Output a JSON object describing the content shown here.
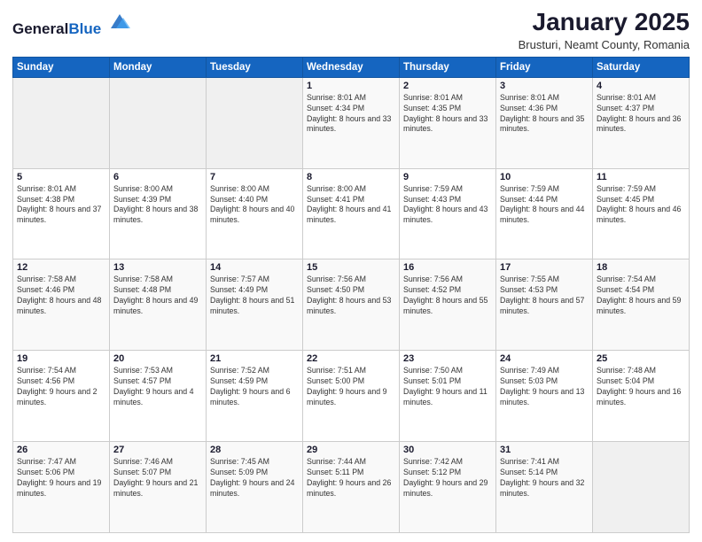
{
  "logo": {
    "general": "General",
    "blue": "Blue"
  },
  "title": {
    "month": "January 2025",
    "location": "Brusturi, Neamt County, Romania"
  },
  "weekdays": [
    "Sunday",
    "Monday",
    "Tuesday",
    "Wednesday",
    "Thursday",
    "Friday",
    "Saturday"
  ],
  "weeks": [
    [
      {
        "day": "",
        "sunrise": "",
        "sunset": "",
        "daylight": ""
      },
      {
        "day": "",
        "sunrise": "",
        "sunset": "",
        "daylight": ""
      },
      {
        "day": "",
        "sunrise": "",
        "sunset": "",
        "daylight": ""
      },
      {
        "day": "1",
        "sunrise": "Sunrise: 8:01 AM",
        "sunset": "Sunset: 4:34 PM",
        "daylight": "Daylight: 8 hours and 33 minutes."
      },
      {
        "day": "2",
        "sunrise": "Sunrise: 8:01 AM",
        "sunset": "Sunset: 4:35 PM",
        "daylight": "Daylight: 8 hours and 33 minutes."
      },
      {
        "day": "3",
        "sunrise": "Sunrise: 8:01 AM",
        "sunset": "Sunset: 4:36 PM",
        "daylight": "Daylight: 8 hours and 35 minutes."
      },
      {
        "day": "4",
        "sunrise": "Sunrise: 8:01 AM",
        "sunset": "Sunset: 4:37 PM",
        "daylight": "Daylight: 8 hours and 36 minutes."
      }
    ],
    [
      {
        "day": "5",
        "sunrise": "Sunrise: 8:01 AM",
        "sunset": "Sunset: 4:38 PM",
        "daylight": "Daylight: 8 hours and 37 minutes."
      },
      {
        "day": "6",
        "sunrise": "Sunrise: 8:00 AM",
        "sunset": "Sunset: 4:39 PM",
        "daylight": "Daylight: 8 hours and 38 minutes."
      },
      {
        "day": "7",
        "sunrise": "Sunrise: 8:00 AM",
        "sunset": "Sunset: 4:40 PM",
        "daylight": "Daylight: 8 hours and 40 minutes."
      },
      {
        "day": "8",
        "sunrise": "Sunrise: 8:00 AM",
        "sunset": "Sunset: 4:41 PM",
        "daylight": "Daylight: 8 hours and 41 minutes."
      },
      {
        "day": "9",
        "sunrise": "Sunrise: 7:59 AM",
        "sunset": "Sunset: 4:43 PM",
        "daylight": "Daylight: 8 hours and 43 minutes."
      },
      {
        "day": "10",
        "sunrise": "Sunrise: 7:59 AM",
        "sunset": "Sunset: 4:44 PM",
        "daylight": "Daylight: 8 hours and 44 minutes."
      },
      {
        "day": "11",
        "sunrise": "Sunrise: 7:59 AM",
        "sunset": "Sunset: 4:45 PM",
        "daylight": "Daylight: 8 hours and 46 minutes."
      }
    ],
    [
      {
        "day": "12",
        "sunrise": "Sunrise: 7:58 AM",
        "sunset": "Sunset: 4:46 PM",
        "daylight": "Daylight: 8 hours and 48 minutes."
      },
      {
        "day": "13",
        "sunrise": "Sunrise: 7:58 AM",
        "sunset": "Sunset: 4:48 PM",
        "daylight": "Daylight: 8 hours and 49 minutes."
      },
      {
        "day": "14",
        "sunrise": "Sunrise: 7:57 AM",
        "sunset": "Sunset: 4:49 PM",
        "daylight": "Daylight: 8 hours and 51 minutes."
      },
      {
        "day": "15",
        "sunrise": "Sunrise: 7:56 AM",
        "sunset": "Sunset: 4:50 PM",
        "daylight": "Daylight: 8 hours and 53 minutes."
      },
      {
        "day": "16",
        "sunrise": "Sunrise: 7:56 AM",
        "sunset": "Sunset: 4:52 PM",
        "daylight": "Daylight: 8 hours and 55 minutes."
      },
      {
        "day": "17",
        "sunrise": "Sunrise: 7:55 AM",
        "sunset": "Sunset: 4:53 PM",
        "daylight": "Daylight: 8 hours and 57 minutes."
      },
      {
        "day": "18",
        "sunrise": "Sunrise: 7:54 AM",
        "sunset": "Sunset: 4:54 PM",
        "daylight": "Daylight: 8 hours and 59 minutes."
      }
    ],
    [
      {
        "day": "19",
        "sunrise": "Sunrise: 7:54 AM",
        "sunset": "Sunset: 4:56 PM",
        "daylight": "Daylight: 9 hours and 2 minutes."
      },
      {
        "day": "20",
        "sunrise": "Sunrise: 7:53 AM",
        "sunset": "Sunset: 4:57 PM",
        "daylight": "Daylight: 9 hours and 4 minutes."
      },
      {
        "day": "21",
        "sunrise": "Sunrise: 7:52 AM",
        "sunset": "Sunset: 4:59 PM",
        "daylight": "Daylight: 9 hours and 6 minutes."
      },
      {
        "day": "22",
        "sunrise": "Sunrise: 7:51 AM",
        "sunset": "Sunset: 5:00 PM",
        "daylight": "Daylight: 9 hours and 9 minutes."
      },
      {
        "day": "23",
        "sunrise": "Sunrise: 7:50 AM",
        "sunset": "Sunset: 5:01 PM",
        "daylight": "Daylight: 9 hours and 11 minutes."
      },
      {
        "day": "24",
        "sunrise": "Sunrise: 7:49 AM",
        "sunset": "Sunset: 5:03 PM",
        "daylight": "Daylight: 9 hours and 13 minutes."
      },
      {
        "day": "25",
        "sunrise": "Sunrise: 7:48 AM",
        "sunset": "Sunset: 5:04 PM",
        "daylight": "Daylight: 9 hours and 16 minutes."
      }
    ],
    [
      {
        "day": "26",
        "sunrise": "Sunrise: 7:47 AM",
        "sunset": "Sunset: 5:06 PM",
        "daylight": "Daylight: 9 hours and 19 minutes."
      },
      {
        "day": "27",
        "sunrise": "Sunrise: 7:46 AM",
        "sunset": "Sunset: 5:07 PM",
        "daylight": "Daylight: 9 hours and 21 minutes."
      },
      {
        "day": "28",
        "sunrise": "Sunrise: 7:45 AM",
        "sunset": "Sunset: 5:09 PM",
        "daylight": "Daylight: 9 hours and 24 minutes."
      },
      {
        "day": "29",
        "sunrise": "Sunrise: 7:44 AM",
        "sunset": "Sunset: 5:11 PM",
        "daylight": "Daylight: 9 hours and 26 minutes."
      },
      {
        "day": "30",
        "sunrise": "Sunrise: 7:42 AM",
        "sunset": "Sunset: 5:12 PM",
        "daylight": "Daylight: 9 hours and 29 minutes."
      },
      {
        "day": "31",
        "sunrise": "Sunrise: 7:41 AM",
        "sunset": "Sunset: 5:14 PM",
        "daylight": "Daylight: 9 hours and 32 minutes."
      },
      {
        "day": "",
        "sunrise": "",
        "sunset": "",
        "daylight": ""
      }
    ]
  ]
}
